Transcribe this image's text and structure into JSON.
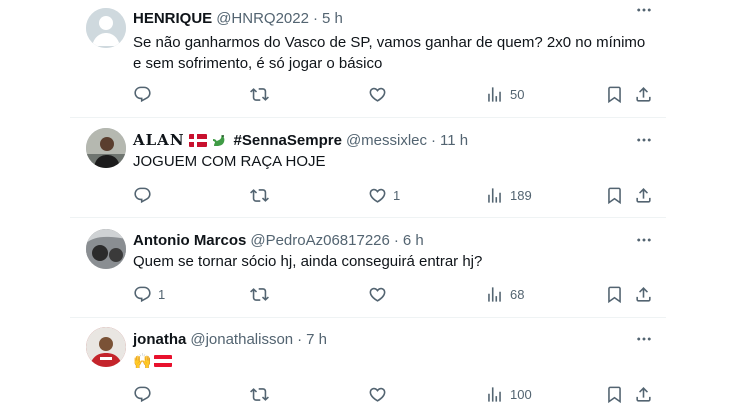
{
  "tweets": [
    {
      "name": "HENRIQUE",
      "handle": "@HNRQ2022",
      "time": "5 h",
      "text": "Se não ganharmos do Vasco de SP, vamos ganhar de quem? 2x0 no mínimo e sem sofrimento, é só jogar o básico",
      "replies": "",
      "retweets": "",
      "likes": "",
      "views": "50"
    },
    {
      "name": "ALAN",
      "name_suffix": "#SennaSempre",
      "handle": "@messixlec",
      "time": "11 h",
      "text": "JOGUEM COM RAÇA HOJE",
      "replies": "",
      "retweets": "",
      "likes": "1",
      "views": "189"
    },
    {
      "name": "Antonio Marcos",
      "handle": "@PedroAz06817226",
      "time": "6 h",
      "text": "Quem se tornar sócio hj, ainda conseguirá entrar hj?",
      "replies": "1",
      "retweets": "",
      "likes": "",
      "views": "68"
    },
    {
      "name": "jonatha",
      "handle": "@jonathalisson",
      "time": "7 h",
      "text_emoji": "🙌",
      "replies": "",
      "retweets": "",
      "likes": "",
      "views": "100"
    }
  ],
  "separator": "·",
  "icons": {
    "reply": "reply-icon",
    "retweet": "retweet-icon",
    "like": "like-icon",
    "views": "views-icon",
    "bookmark": "bookmark-icon",
    "share": "share-icon",
    "more": "more-icon"
  },
  "colors": {
    "text": "#0f1419",
    "muted": "#536471",
    "divider": "#eff3f4"
  }
}
